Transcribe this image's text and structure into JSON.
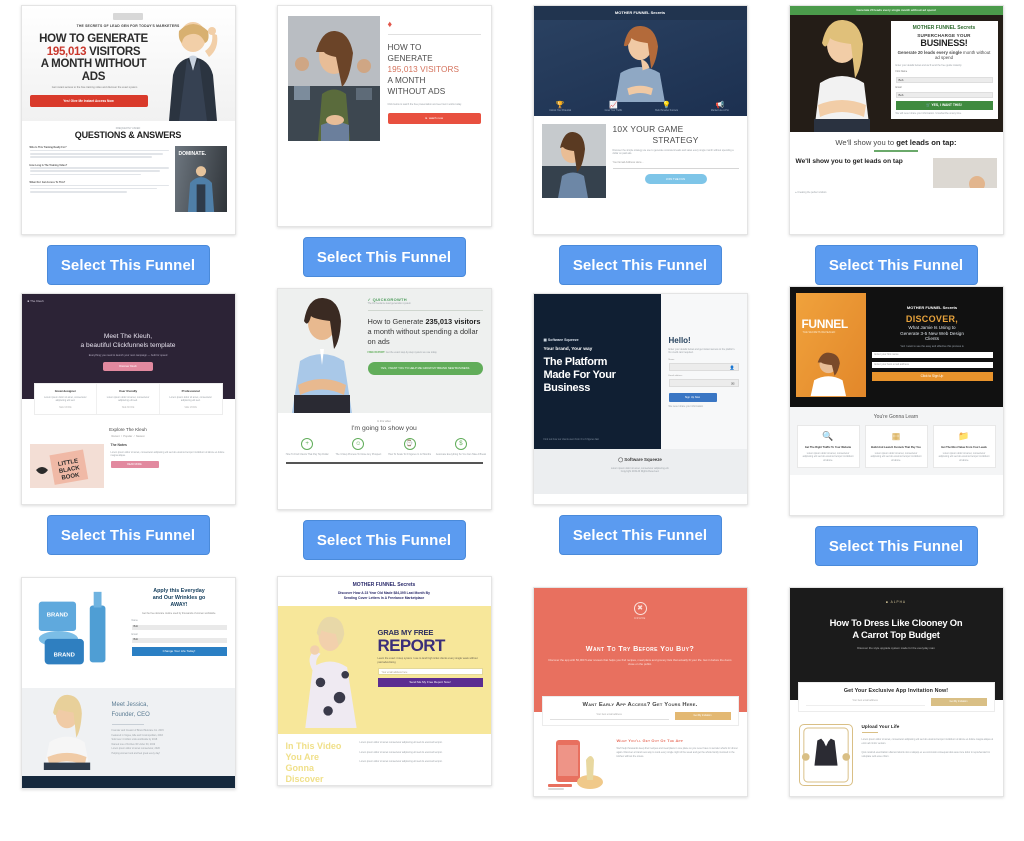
{
  "page": {
    "background": "#ffffff",
    "button_color": "#5b9bf0",
    "button_text_color": "#ffffff",
    "columns": 4,
    "rows": 3
  },
  "common": {
    "select_label": "Select This Funnel"
  },
  "funnels": [
    {
      "id": 1,
      "name": "195,013 Visitors Red Sales Page",
      "select_label": "Select This Funnel",
      "content": {
        "preheadline": "THE SECRETS OF LEAD GEN FOR TODAY'S MARKETERS",
        "headline_line1": "HOW TO GENERATE",
        "headline_number": "195,013",
        "headline_line2": "VISITORS",
        "headline_line3": "A MONTH WITHOUT",
        "headline_line4": "ADS",
        "subtext": "Get instant access to the free training video and discover the exact system",
        "cta": "Yes! Give Me Instant Access Now",
        "section_eyebrow": "FREQUENTLY ASKED",
        "section_title": "QUESTIONS & ANSWERS",
        "faq": [
          "Who Is This Training Really For?",
          "How Long Is The Training Video?",
          "When Do I Get Access To This?"
        ],
        "book_title": "DOMINATE."
      }
    },
    {
      "id": 2,
      "name": "Clean Minimal Video Squeeze",
      "select_label": "Select This Funnel",
      "content": {
        "logo_icon": "diamond-icon",
        "headline_line1": "HOW TO",
        "headline_line2": "GENERATE",
        "headline_highlight": "195,013 VISITORS",
        "headline_line3": "A MONTH",
        "headline_line4": "WITHOUT ADS",
        "subtext": "Click below to watch the free presentation and see how it works today.",
        "cta": "watch now",
        "cta_icon": "play-icon"
      }
    },
    {
      "id": 3,
      "name": "Navy 10X Your Game Strategy",
      "select_label": "Select This Funnel",
      "content": {
        "logo": "MOTHER FUNNEL Secrets",
        "features": [
          {
            "icon": "trophy-icon",
            "label": "Unlock Your Potential"
          },
          {
            "icon": "chart-icon",
            "label": "Grow Your Traffic"
          },
          {
            "icon": "bulb-icon",
            "label": "Build Smarter Funnels"
          },
          {
            "icon": "megaphone-icon",
            "label": "Market Like A Pro"
          }
        ],
        "section_title_line1": "10X YOUR GAME",
        "section_title_line2": "STRATEGY",
        "body": "Discover the simple strategy we use to generate consistent leads and sales every single month without spending a dollar on paid ads.",
        "input_placeholder": "Your Email Address Here...",
        "cta": "JOIN THE FUN"
      }
    },
    {
      "id": 4,
      "name": "Mother Funnel Secrets Lead Magnet",
      "select_label": "Select This Funnel",
      "content": {
        "top_bar": "Generate 20 leads every single month without ad spend",
        "logo": "MOTHER FUNNEL Secrets",
        "supercharge": "SUPERCHARGE YOUR",
        "business": "BUSINESS!",
        "sub_bold": "Generate 20 leads every single",
        "sub_rest": "month without ad spend",
        "form_note": "Enter your details below and we'll send the free guide instantly.",
        "field1_label": "First Name",
        "field1_value": "Bob",
        "field2_label": "Email",
        "field2_value": "Bob",
        "cta": "YES, I WANT THIS!",
        "disclaimer": "We will never share your information. Unsubscribe at any time.",
        "lead_line_plain": "We'll show you to ",
        "lead_line_bold": "get leads on tap:",
        "lower_headline": "We'll show you to get leads on tap",
        "bullet": "Creating the perfect visitors"
      }
    },
    {
      "id": 5,
      "name": "The Kleuh Dark Template",
      "select_label": "Select This Funnel",
      "content": {
        "logo": "The Kleuh",
        "headline_line1": "Meet The Kleuh,",
        "headline_line2": "a beautiful Clickfunnels template",
        "subtext": "Everything you need to launch your next campaign — built for speed",
        "cta": "Discover Kleuh",
        "cards": [
          {
            "title": "Great designer",
            "body": "Lorem ipsum dolor sit amet, consectetur adipiscing elit sed.",
            "link": "SEE MORE"
          },
          {
            "title": "User friendly",
            "body": "Lorem ipsum dolor sit amet, consectetur adipiscing elit sed.",
            "link": "SEE MORE"
          },
          {
            "title": "Professional",
            "body": "Lorem ipsum dolor sit amet, consectetur adipiscing elit sed.",
            "link": "SEE MORE"
          }
        ],
        "explore_title": "Explore The Kleuh",
        "tabs": [
          "Recent",
          "Popular",
          "Newest"
        ],
        "post_title": "The Notes",
        "post_body": "Lorem ipsum dolor sit amet, consectetur adipiscing elit sed do eiusmod tempor incididunt ut labore et dolore magna aliqua.",
        "post_cta": "READ MORE",
        "book_art": "LITTLE BLACK BOOK"
      }
    },
    {
      "id": 6,
      "name": "QuickGrowth 235,013 Visitors",
      "select_label": "Select This Funnel",
      "content": {
        "brand": "QUICKGROWTH",
        "tagline": "The #1 freelance lead generation system",
        "headline_plain1": "How to Generate ",
        "headline_bold1": "235,013",
        "headline_bold2": "visitors",
        "headline_plain2": " a month without spending a dollar on ads",
        "free_label": "FREE REPORT:",
        "free_rest": "Get the exact step-by-step system we use today",
        "cta": "YES, I WANT YOU TO HELP ME GROW MY BRAND NEW BUSINESS",
        "eyebrow": "In this video",
        "section_title": "I'm going to show you",
        "icons": [
          {
            "icon": "plus-circle-icon",
            "label": "How To Find Clients That Pay Top Dollar"
          },
          {
            "icon": "smile-circle-icon",
            "label": "The 3-Step Process To Close Any Prospect"
          },
          {
            "icon": "clock-circle-icon",
            "label": "How To Scale To 6 Figures In 12 Months"
          },
          {
            "icon": "dollar-circle-icon",
            "label": "Automate Everything So You Can Take A Break"
          }
        ]
      }
    },
    {
      "id": 7,
      "name": "Software Squeeze Platform",
      "select_label": "Select This Funnel",
      "content": {
        "logo": "Software Squeeze",
        "eyebrow": "Your brand, Your way",
        "headline_line1": "The Platform",
        "headline_line2": "Made For Your",
        "headline_line3": "Business",
        "footnote": "Find out how our clients went from 0 to 6 figures fast",
        "form_title": "Hello!",
        "form_body": "Enter your details below and get instant access to the platform. No credit card required.",
        "field1_label": "Name",
        "field1_icon": "person-icon",
        "field2_label": "Email address",
        "field2_icon": "envelope-icon",
        "cta": "Sign Up Now",
        "form_note": "We never share your information",
        "footer_brand": "Software Squeeze",
        "footer_line1": "Lorem ipsum dolor sit amet, consectetur adipiscing elit.",
        "footer_line2": "Copyright 2019 All Rights Reserved."
      }
    },
    {
      "id": 8,
      "name": "Discover Web Design Clients",
      "select_label": "Select This Funnel",
      "content": {
        "logo": "MOTHER FUNNEL Secrets",
        "book_title": "FUNNEL",
        "book_subtitle": "THE SECRETS REVEALED",
        "discover": "DISCOVER,",
        "sub_line1": "What Jamie Is Using to",
        "sub_line2": "Generate 3-5 New Web Design",
        "sub_line3": "Clients",
        "small_text": "Yes! I want to see the easy and effective this process is",
        "field1_placeholder": "Enter your first name",
        "field2_placeholder": "Enter your best email address",
        "cta": "Click to Sign Up",
        "section_title": "You're Gonna Learn",
        "tiles": [
          {
            "icon": "magnifier-icon",
            "title": "Get The Right Traffic To Your Website",
            "body": "Lorem ipsum dolor sit amet, consectetur adipiscing elit sed do eiusmod tempor incididunt ut labore."
          },
          {
            "icon": "grid-icon",
            "title": "Build And Launch Funnels That Pay You",
            "body": "Lorem ipsum dolor sit amet, consectetur adipiscing elit sed do eiusmod tempor incididunt ut labore."
          },
          {
            "icon": "folder-icon",
            "title": "Get The Most Value From Your Leads",
            "body": "Lorem ipsum dolor sit amet, consectetur adipiscing elit sed do eiusmod tempor incididunt ut labore."
          }
        ]
      }
    },
    {
      "id": 9,
      "name": "Skincare Brand Optin",
      "select_label": "Select This Funnel",
      "content": {
        "product_label": "BRAND",
        "headline_line1": "Apply this Everyday",
        "headline_line2": "and Our Wrinkles go",
        "headline_line3": "AWAY!",
        "subtext": "Get the free skincare routine used by thousands of women worldwide.",
        "field1_label": "Name",
        "field1_value": "Bob",
        "field2_label": "Email",
        "field2_value": "Bob",
        "cta": "Change Your Life Today!",
        "bio_title": "Meet Jessica,",
        "bio_subtitle": "Founder, CEO",
        "bio_points": [
          "Founder and Creator of Brand Skincare Co. 2015",
          "Featured in Vogue, Elle and Cosmopolitan, 2016",
          "Sold over 4 million units worldwide by 2018",
          "Named one of Forbes 30 Under 30, 2019",
          "Lorem ipsum dolor sit amet consectetur, 2020",
          "Helping women look and feel great every day!"
        ]
      }
    },
    {
      "id": 10,
      "name": "Grab My Free Report Yellow",
      "select_label": "Select This Funnel",
      "content": {
        "logo": "MOTHER FUNNEL Secrets",
        "discover_line1": "Discover How A 23 Year Old Made $84,395 Last Month By",
        "discover_line2": "Sending Cover Letters In A Freelance Marketplace",
        "grab": "GRAB MY FREE",
        "report": "REPORT",
        "small_text": "Learn the exact 4 step system I use to land high ticket clients every single week without paid advertising",
        "field_placeholder": "Your email address here",
        "cta": "Send Me My Free Report Now!",
        "video_line1": "In This Video",
        "video_line2": "You Are",
        "video_line3": "Gonna",
        "video_line4": "Discover",
        "video_body": "Lorem ipsum dolor sit amet, consectetur adipiscing elit sed do eiusmod tempor.",
        "bullets": [
          "Lorem ipsum dolor sit amet consectetur adipiscing elit sed do eiusmod tempor.",
          "Lorem ipsum dolor sit amet consectetur adipiscing elit sed do eiusmod tempor.",
          "Lorem ipsum dolor sit amet consectetur adipiscing elit sed do eiusmod tempor."
        ]
      }
    },
    {
      "id": 11,
      "name": "Coral App Early Access",
      "select_label": "Select This Funnel",
      "content": {
        "logo_icon": "x-circle-icon",
        "logo_text": "CRAVE",
        "headline": "Want To Try Before You Buy?",
        "body": "Discover the app with 50,000 5-star reviews that helps you find recipes, meal plans and grocery lists that actually fit your life. Get in before the doors close on the public.",
        "bar_title": "Want Early App Access? Get Yours Here.",
        "input_placeholder": "Your best email address",
        "cta": "Get My Invitation",
        "lower_title": "What You'll Get Out Of The App",
        "lower_body": "We'll help thousands keep their recipes and meal plans in one place so you never have to wonder what's for dinner again. Discover a brand new way to cook every single night of the week and get the whole family involved in the kitchen without the stress."
      }
    },
    {
      "id": 12,
      "name": "Clooney On A Carrot Top Budget",
      "select_label": "Select This Funnel",
      "content": {
        "logo": "ALPHA",
        "headline_line1": "How To Dress Like Clooney On",
        "headline_line2": "A Carrot Top Budget",
        "subtext": "Discover the style upgrade system made for the everyday man",
        "bar_title": "Get Your Exclusive App Invitation Now!",
        "input_placeholder": "Your best email address",
        "cta": "Get My Invitation",
        "lower_title": "Upload Your Life",
        "lower_body1": "Lorem ipsum dolor sit amet, consectetur adipiscing elit sed do eiusmod tempor incididunt ut labore et dolore magna aliqua ut enim ad minim veniam.",
        "lower_body2": "Quis nostrud exercitation ullamco laboris nisi ut aliquip ex ea commodo consequat duis aute irure dolor in reprehenderit in voluptate velit esse cillum."
      }
    }
  ]
}
